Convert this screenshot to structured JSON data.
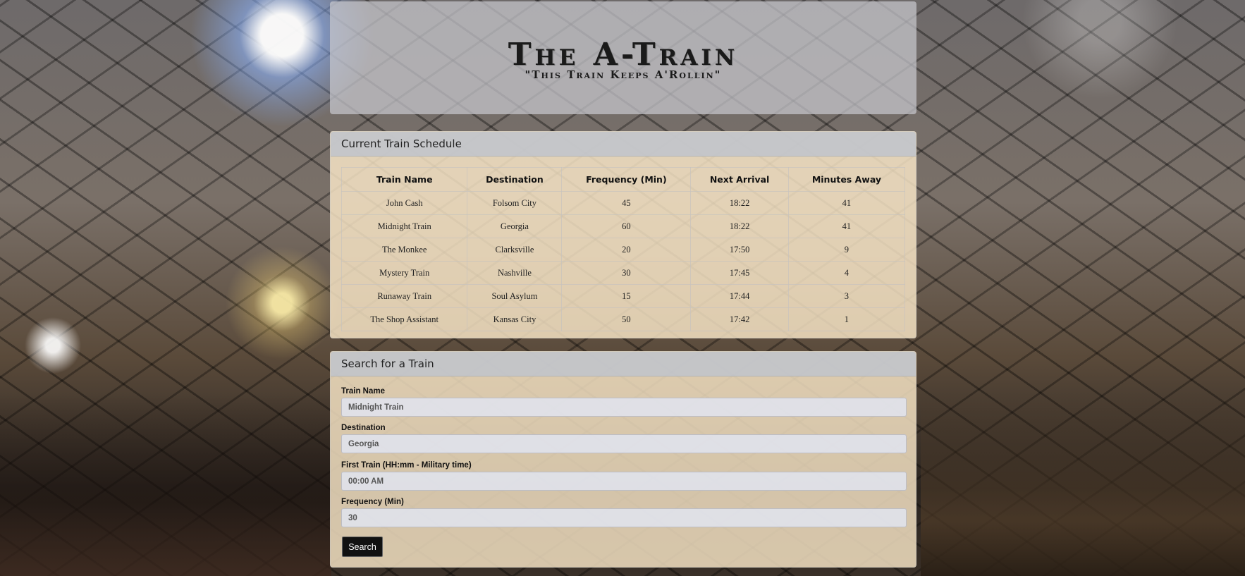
{
  "header": {
    "title": "The A-Train",
    "subtitle": "\"This Train Keeps A'Rollin\""
  },
  "schedule": {
    "heading": "Current Train Schedule",
    "columns": [
      "Train Name",
      "Destination",
      "Frequency (Min)",
      "Next Arrival",
      "Minutes Away"
    ],
    "rows": [
      [
        "John Cash",
        "Folsom City",
        "45",
        "18:22",
        "41"
      ],
      [
        "Midnight Train",
        "Georgia",
        "60",
        "18:22",
        "41"
      ],
      [
        "The Monkee",
        "Clarksville",
        "20",
        "17:50",
        "9"
      ],
      [
        "Mystery Train",
        "Nashville",
        "30",
        "17:45",
        "4"
      ],
      [
        "Runaway Train",
        "Soul Asylum",
        "15",
        "17:44",
        "3"
      ],
      [
        "The Shop Assistant",
        "Kansas City",
        "50",
        "17:42",
        "1"
      ]
    ]
  },
  "search": {
    "heading": "Search for a Train",
    "fields": [
      {
        "label": "Train Name",
        "value": "Midnight Train"
      },
      {
        "label": "Destination",
        "value": "Georgia"
      },
      {
        "label": "First Train (HH:mm - Military time)",
        "value": "00:00 AM"
      },
      {
        "label": "Frequency (Min)",
        "value": "30"
      }
    ],
    "button_label": "Search"
  },
  "colors": {
    "panel_body": "#fae8c8",
    "panel_heading": "#bec3cd",
    "button": "#111111"
  }
}
